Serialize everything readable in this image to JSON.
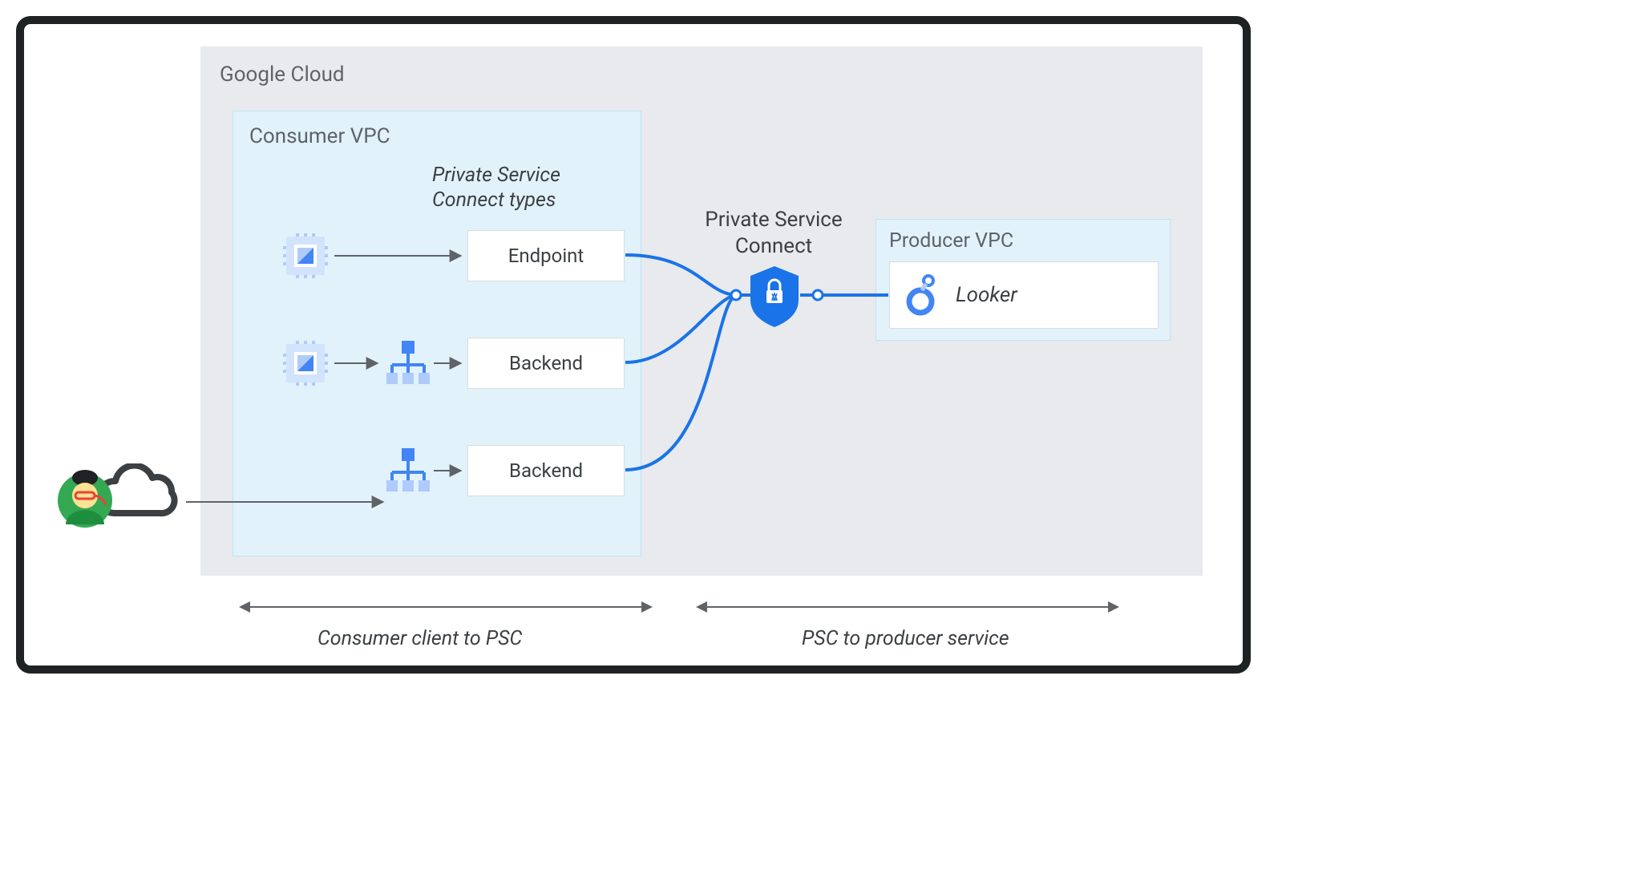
{
  "labels": {
    "gcloud": "Google Cloud",
    "consumer_vpc": "Consumer VPC",
    "psc_types_heading": "Private Service Connect types",
    "endpoint": "Endpoint",
    "backend1": "Backend",
    "backend2": "Backend",
    "psc_center": "Private Service Connect",
    "producer_vpc": "Producer VPC",
    "looker": "Looker",
    "range_left": "Consumer client to PSC",
    "range_right": "PSC to producer service"
  },
  "icons": {
    "user": "user-icon",
    "cloud": "cloud-icon",
    "compute": "compute-icon",
    "loadbalancer": "load-balancer-icon",
    "shield": "psc-shield-icon",
    "looker": "looker-icon"
  },
  "colors": {
    "outer_border": "#1e2223",
    "gcloud_bg": "#e8eaed",
    "vpc_bg": "#e1f2fb",
    "box_border": "#dadce0",
    "text_muted": "#5f6368",
    "text_dark": "#3c4043",
    "blue_line": "#1a73e8",
    "blue_fill": "#4285f4"
  }
}
